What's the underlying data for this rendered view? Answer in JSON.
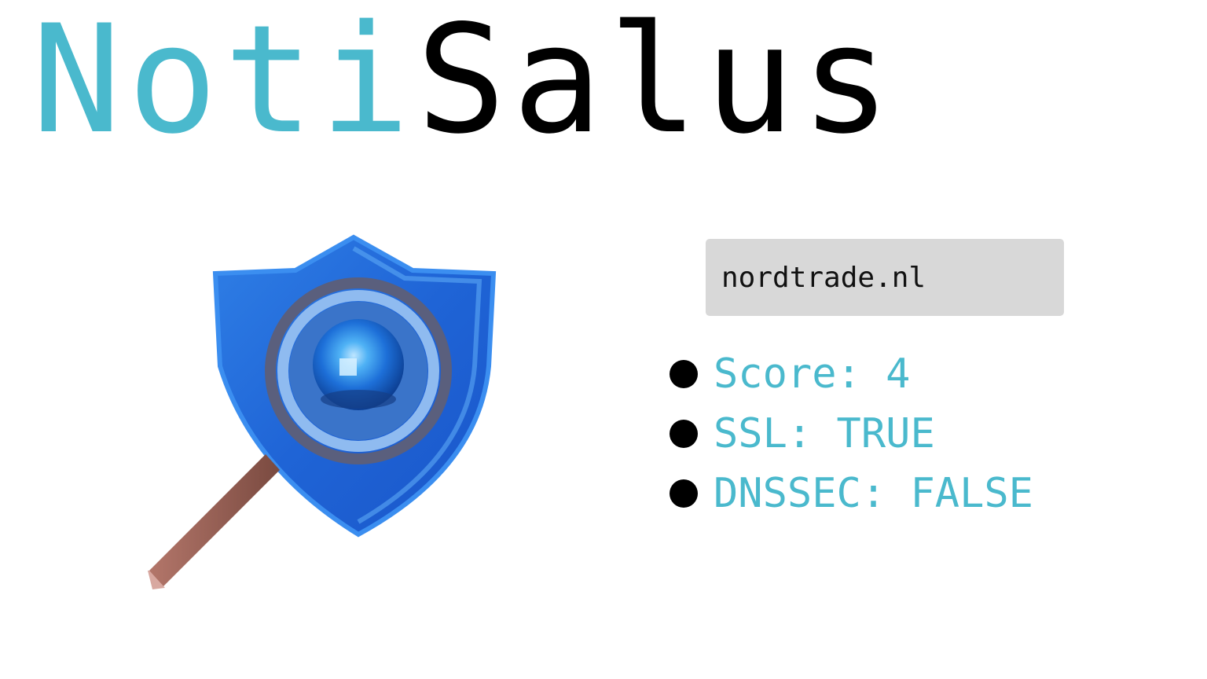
{
  "logo": {
    "part1": "Noti",
    "part2": "Salus"
  },
  "colors": {
    "accent": "#4ab9cd",
    "logo_dark": "#000000",
    "input_bg": "#d8d8d8",
    "button_bg": "#aaaaaa"
  },
  "icon": "shield-magnifier-icon",
  "search": {
    "value": "nordtrade.nl"
  },
  "results": [
    {
      "text": "Score: 4"
    },
    {
      "text": "SSL: TRUE"
    },
    {
      "text": "DNSSEC: FALSE"
    }
  ]
}
